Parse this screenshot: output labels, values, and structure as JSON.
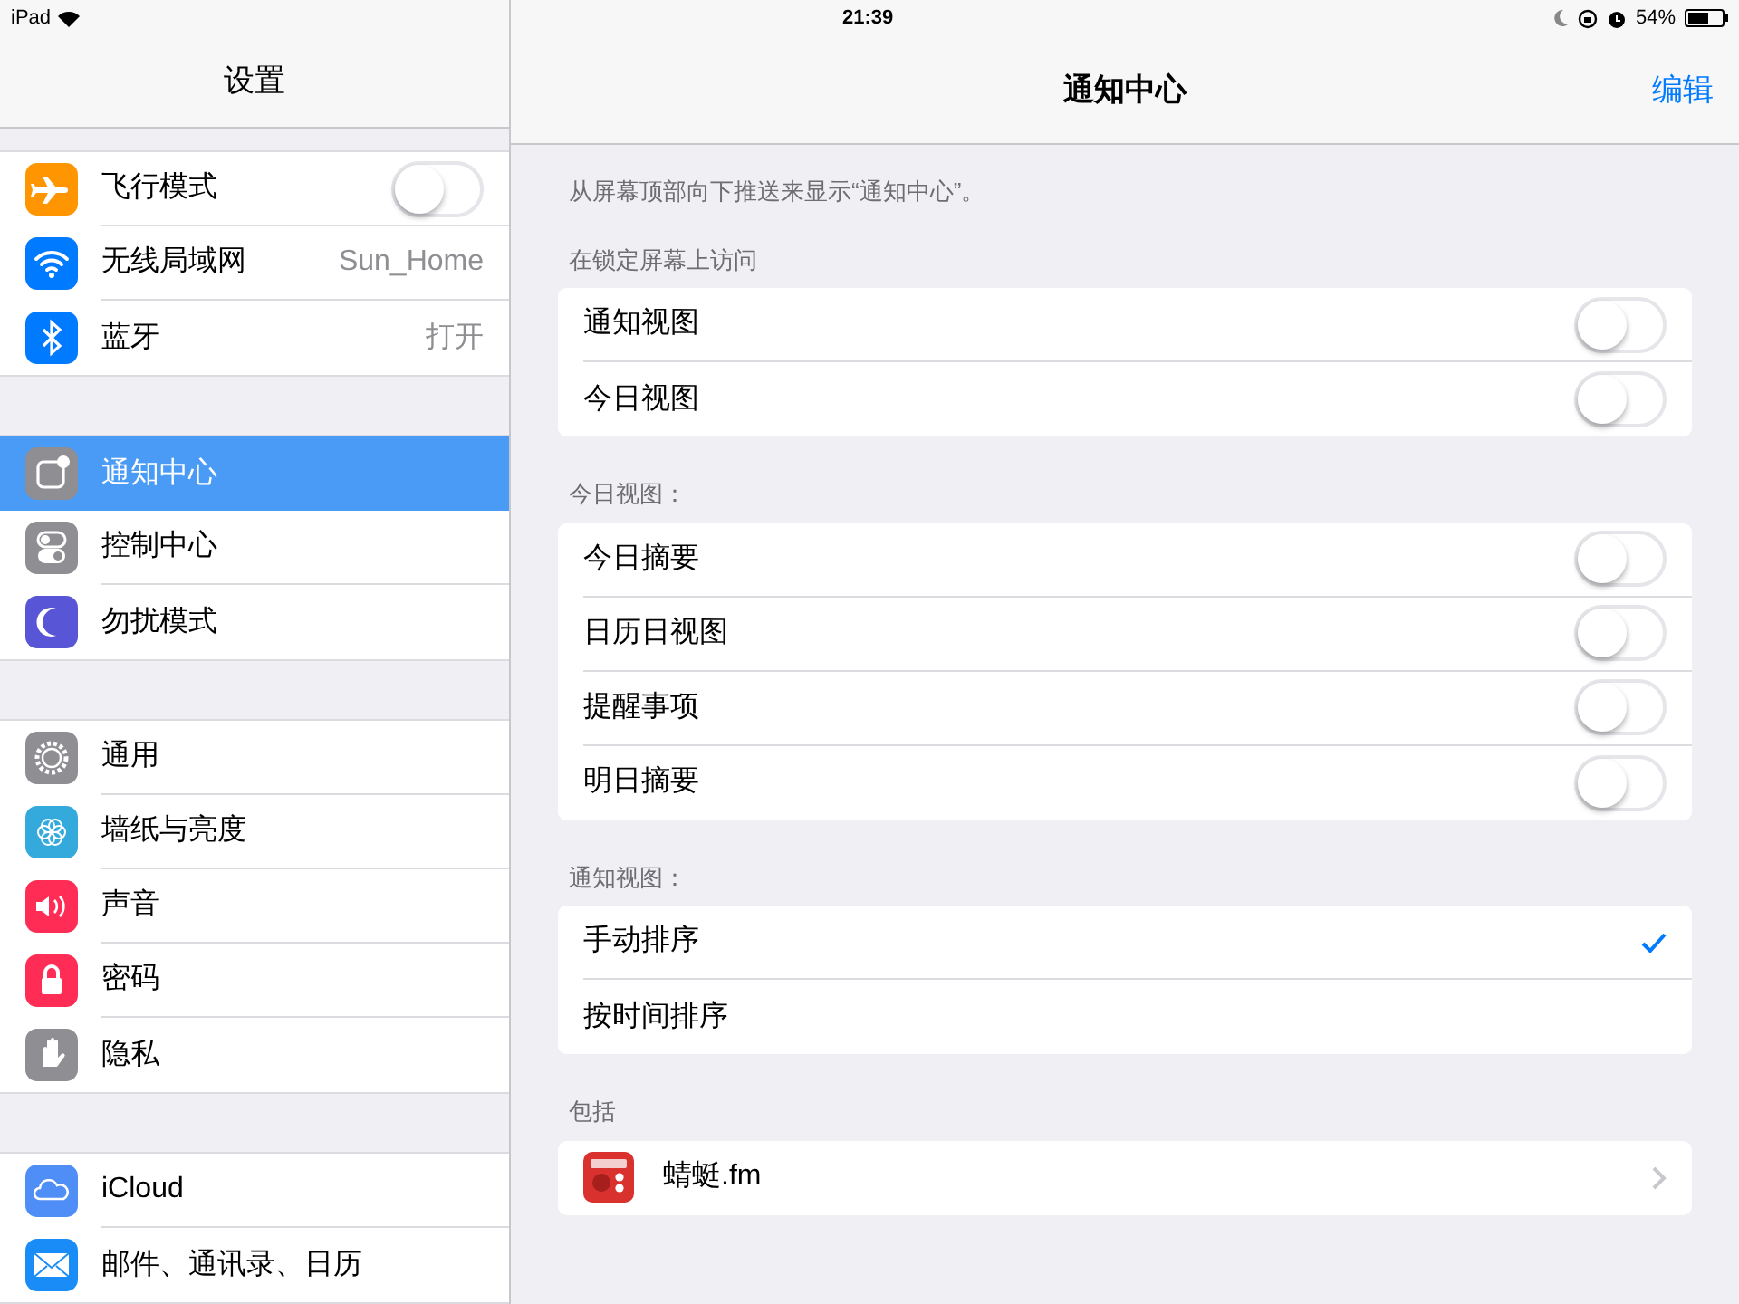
{
  "status_bar": {
    "device": "iPad",
    "time": "21:39",
    "battery": "54%"
  },
  "sidebar": {
    "title": "设置",
    "groups": [
      [
        {
          "label": "飞行模式",
          "kind": "toggle",
          "on": false,
          "selected": false
        },
        {
          "label": "无线局域网",
          "kind": "value",
          "value": "Sun_Home",
          "selected": false
        },
        {
          "label": "蓝牙",
          "kind": "value",
          "value": "打开",
          "selected": false
        }
      ],
      [
        {
          "label": "通知中心",
          "kind": "plain",
          "selected": true
        },
        {
          "label": "控制中心",
          "kind": "plain",
          "selected": false
        },
        {
          "label": "勿扰模式",
          "kind": "plain",
          "selected": false
        }
      ],
      [
        {
          "label": "通用",
          "kind": "plain",
          "selected": false
        },
        {
          "label": "墙纸与亮度",
          "kind": "plain",
          "selected": false
        },
        {
          "label": "声音",
          "kind": "plain",
          "selected": false
        },
        {
          "label": "密码",
          "kind": "plain",
          "selected": false
        },
        {
          "label": "隐私",
          "kind": "plain",
          "selected": false
        }
      ],
      [
        {
          "label": "iCloud",
          "kind": "plain",
          "selected": false
        },
        {
          "label": "邮件、通讯录、日历",
          "kind": "plain",
          "selected": false
        }
      ]
    ]
  },
  "detail": {
    "title": "通知中心",
    "edit_button": "编辑",
    "intro": "从屏幕顶部向下推送来显示“通知中心”。",
    "sections": [
      {
        "header": "在锁定屏幕上访问",
        "rows": [
          {
            "label": "通知视图",
            "kind": "toggle",
            "on": false
          },
          {
            "label": "今日视图",
            "kind": "toggle",
            "on": false
          }
        ]
      },
      {
        "header": "今日视图：",
        "rows": [
          {
            "label": "今日摘要",
            "kind": "toggle",
            "on": false
          },
          {
            "label": "日历日视图",
            "kind": "toggle",
            "on": false
          },
          {
            "label": "提醒事项",
            "kind": "toggle",
            "on": false
          },
          {
            "label": "明日摘要",
            "kind": "toggle",
            "on": false
          }
        ]
      },
      {
        "header": "通知视图：",
        "rows": [
          {
            "label": "手动排序",
            "kind": "option",
            "selected": true
          },
          {
            "label": "按时间排序",
            "kind": "option",
            "selected": false
          }
        ]
      },
      {
        "header": "包括",
        "rows": [
          {
            "label": "蜻蜓.fm",
            "kind": "app"
          }
        ]
      }
    ]
  }
}
